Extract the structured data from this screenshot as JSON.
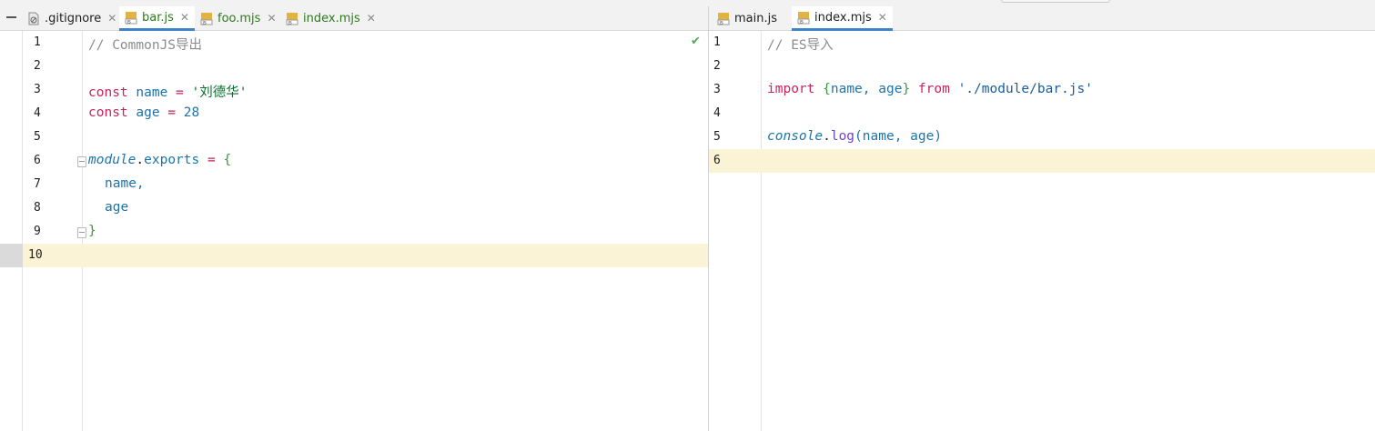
{
  "left_pane": {
    "tabs": [
      {
        "label": ".gitignore",
        "icon": "gitignore-file-icon",
        "active": false,
        "green": false
      },
      {
        "label": "bar.js",
        "icon": "js-file-icon",
        "active": true,
        "green": true
      },
      {
        "label": "foo.mjs",
        "icon": "js-file-icon",
        "active": false,
        "green": true
      },
      {
        "label": "index.mjs",
        "icon": "js-file-icon",
        "active": false,
        "green": true
      }
    ],
    "lines": [
      {
        "n": "1"
      },
      {
        "n": "2"
      },
      {
        "n": "3"
      },
      {
        "n": "4"
      },
      {
        "n": "5"
      },
      {
        "n": "6"
      },
      {
        "n": "7"
      },
      {
        "n": "8"
      },
      {
        "n": "9"
      },
      {
        "n": "10"
      }
    ],
    "code": {
      "l1_comment": "// CommonJS导出",
      "l3_kw": "const",
      "l3_name": "name",
      "l3_eq": "=",
      "l3_str": "'刘德华'",
      "l4_kw": "const",
      "l4_name": "age",
      "l4_eq": "=",
      "l4_num": "28",
      "l6_obj": "module",
      "l6_dot": ".",
      "l6_prop": "exports",
      "l6_eq": "=",
      "l6_brace": "{",
      "l7_text": "name,",
      "l8_text": "age",
      "l9_brace": "}"
    },
    "inspection_icon": "check-icon"
  },
  "right_pane": {
    "tabs": [
      {
        "label": "main.js",
        "icon": "js-file-icon",
        "active": false,
        "green": false
      },
      {
        "label": "index.mjs",
        "icon": "js-file-icon",
        "active": true,
        "green": false
      }
    ],
    "lines": [
      {
        "n": "1"
      },
      {
        "n": "2"
      },
      {
        "n": "3"
      },
      {
        "n": "4"
      },
      {
        "n": "5"
      },
      {
        "n": "6"
      }
    ],
    "code": {
      "l1_comment": "// ES导入",
      "l3_kw": "import",
      "l3_open": "{",
      "l3_names": "name, age",
      "l3_close": "}",
      "l3_from": "from",
      "l3_str": "'./module/bar.js'",
      "l5_obj": "console",
      "l5_dot": ".",
      "l5_fn": "log",
      "l5_args": "(name, age)"
    }
  },
  "colors": {
    "current_line": "#fbf3d5",
    "active_tab_underline": "#4083c9",
    "keyword": "#c7245a",
    "identifier": "#1e73a8",
    "string": "#0b6e2f",
    "comment": "#8c8c8c"
  }
}
